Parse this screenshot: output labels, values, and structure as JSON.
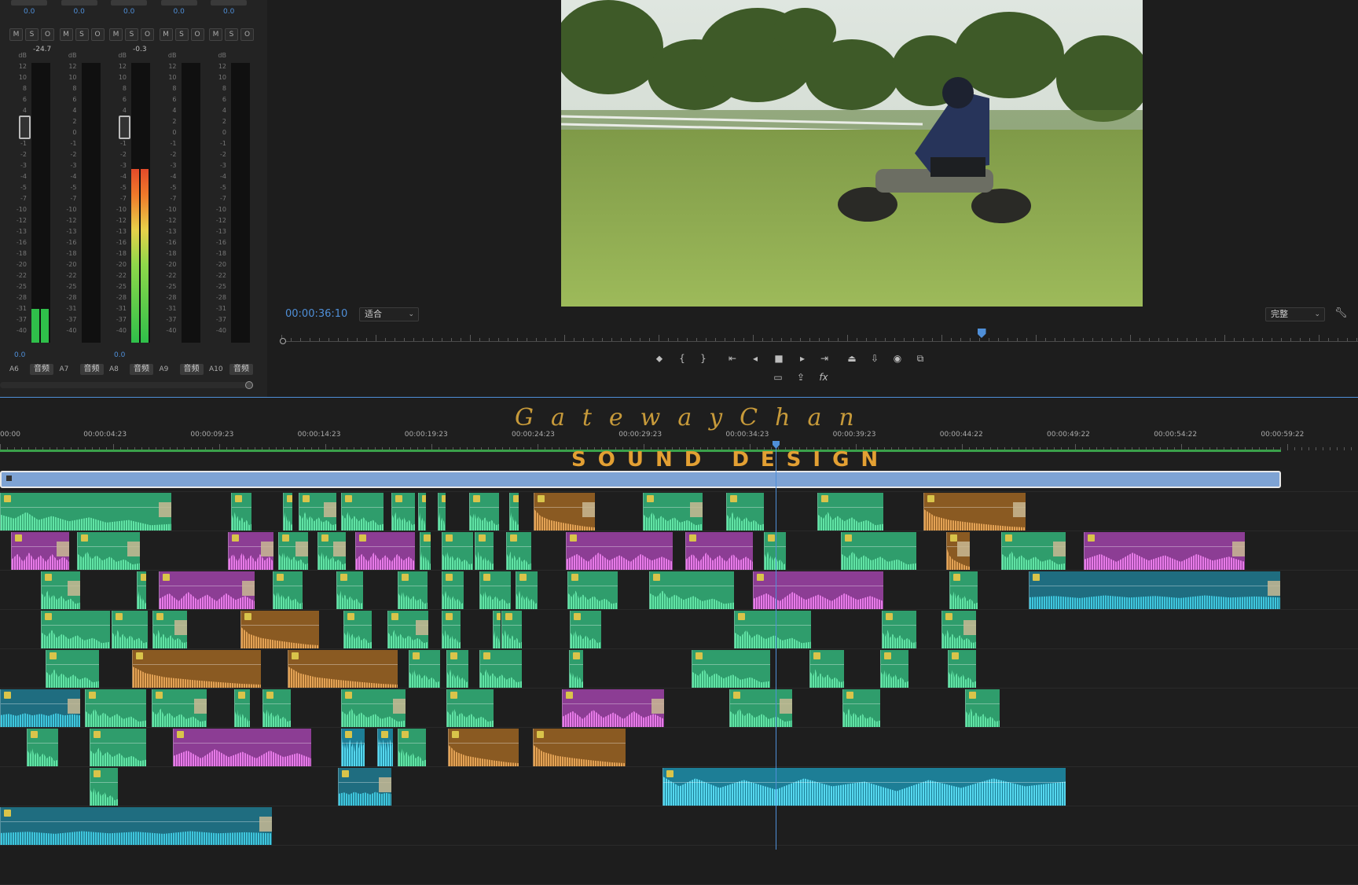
{
  "mixer": {
    "db_scale": [
      "dB",
      "12",
      "10",
      "8",
      "6",
      "4",
      "2",
      "0",
      "-1",
      "-2",
      "-3",
      "-4",
      "-5",
      "-7",
      "-10",
      "-12",
      "-13",
      "-16",
      "-18",
      "-20",
      "-22",
      "-25",
      "-28",
      "-31",
      "-37",
      "-40"
    ],
    "channels": [
      {
        "name": "A6",
        "tag": "音频",
        "top_value": "0.0",
        "peak": "-24.7",
        "bottom_value": "0.0",
        "m": "M",
        "s": "S",
        "o": "O",
        "meter_level": 0.12,
        "fader_pct": 0.22
      },
      {
        "name": "A7",
        "tag": "音频",
        "top_value": "0.0",
        "peak": "",
        "bottom_value": "",
        "m": "M",
        "s": "S",
        "o": "O",
        "meter_level": 0.0,
        "fader_pct": 0.0
      },
      {
        "name": "A8",
        "tag": "音频",
        "top_value": "0.0",
        "peak": "-0.3",
        "bottom_value": "0.0",
        "m": "M",
        "s": "S",
        "o": "O",
        "meter_level": 0.62,
        "fader_pct": 0.22
      },
      {
        "name": "A9",
        "tag": "音频",
        "top_value": "0.0",
        "peak": "",
        "bottom_value": "",
        "m": "M",
        "s": "S",
        "o": "O",
        "meter_level": 0.0,
        "fader_pct": 0.0
      },
      {
        "name": "A10",
        "tag": "音频",
        "top_value": "0.0",
        "peak": "",
        "bottom_value": "",
        "m": "M",
        "s": "S",
        "o": "O",
        "meter_level": 0.0,
        "fader_pct": 0.0
      }
    ]
  },
  "program": {
    "timecode": "00:00:36:10",
    "fit": "适合",
    "quality": "完整",
    "playhead_fraction": 0.65
  },
  "transport_icons": [
    "marker-icon",
    "mark-in-icon",
    "mark-out-icon",
    "go-to-in-icon",
    "step-back-icon",
    "stop-icon",
    "step-forward-icon",
    "go-to-out-icon",
    "lift-icon",
    "extract-icon",
    "export-frame-icon",
    "compare-icon",
    "safe-margins-icon",
    "export-icon",
    "fx-icon"
  ],
  "timeline": {
    "watermark": "GatewayChan",
    "title_overlay": "SOUND DESIGN",
    "time_labels": [
      "00:00",
      "00:00:04:23",
      "00:00:09:23",
      "00:00:14:23",
      "00:00:19:23",
      "00:00:24:23",
      "00:00:29:23",
      "00:00:34:23",
      "00:00:39:23",
      "00:00:44:22",
      "00:00:49:22",
      "00:00:54:22",
      "00:00:59:22"
    ]
  },
  "colors": {
    "accent": "#4f8fd8",
    "green_clip": "#2f9d6c",
    "pink_clip": "#8c3d94",
    "orange_clip": "#8a5a22",
    "teal_clip": "#1f6d80",
    "title": "#e3a033"
  }
}
